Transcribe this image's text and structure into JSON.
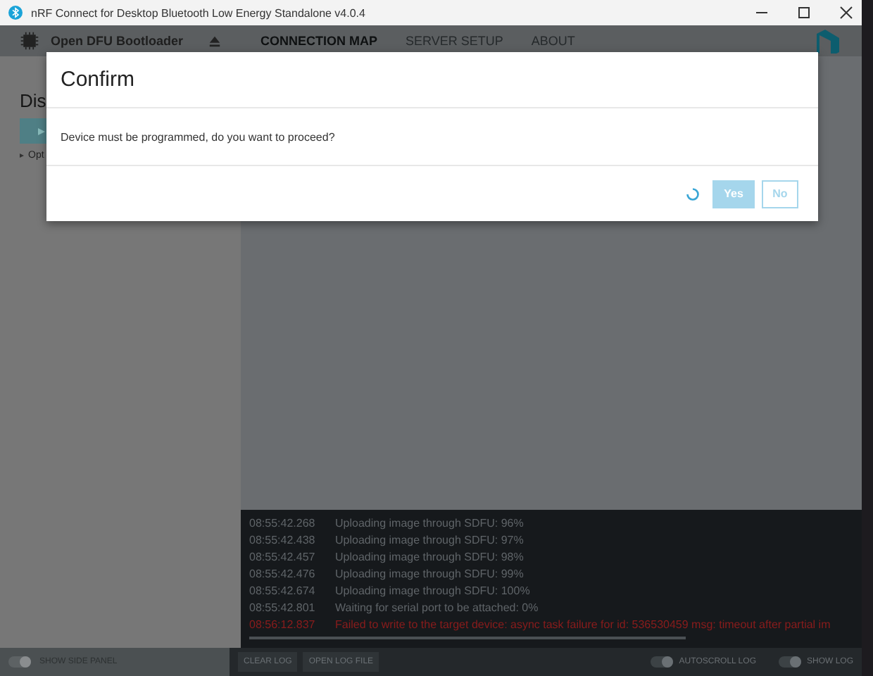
{
  "window": {
    "title": "nRF Connect for Desktop Bluetooth Low Energy Standalone v4.0.4"
  },
  "header": {
    "device_name": "Open DFU Bootloader",
    "tabs": [
      {
        "label": "CONNECTION MAP",
        "selected": true
      },
      {
        "label": "SERVER SETUP",
        "selected": false
      },
      {
        "label": "ABOUT",
        "selected": false
      }
    ]
  },
  "sidebar": {
    "heading": "Dis",
    "option": "Opt",
    "toggle": {
      "label": "SHOW SIDE PANEL",
      "on": true
    }
  },
  "dialog": {
    "title": "Confirm",
    "message": "Device must be programmed, do you want to proceed?",
    "busy": true,
    "buttons": [
      {
        "label": "Yes",
        "kind": "primary",
        "disabled": true
      },
      {
        "label": "No",
        "kind": "secondary",
        "disabled": true
      }
    ]
  },
  "log": {
    "entries": [
      {
        "time": "08:55:42.268",
        "message": "Uploading image through SDFU: 96%",
        "kind": "info"
      },
      {
        "time": "08:55:42.438",
        "message": "Uploading image through SDFU: 97%",
        "kind": "info"
      },
      {
        "time": "08:55:42.457",
        "message": "Uploading image through SDFU: 98%",
        "kind": "info"
      },
      {
        "time": "08:55:42.476",
        "message": "Uploading image through SDFU: 99%",
        "kind": "info"
      },
      {
        "time": "08:55:42.674",
        "message": "Uploading image through SDFU: 100%",
        "kind": "info"
      },
      {
        "time": "08:55:42.801",
        "message": "Waiting for serial port to be attached: 0%",
        "kind": "info"
      },
      {
        "time": "08:56:12.837",
        "message": "Failed to write to the target device: async task failure for id: 536530459 msg: timeout after partial im",
        "kind": "error"
      }
    ],
    "buttons": [
      "CLEAR LOG",
      "OPEN LOG FILE"
    ],
    "toggles": [
      {
        "label": "AUTOSCROLL LOG",
        "on": true
      },
      {
        "label": "SHOW LOG",
        "on": true
      }
    ]
  }
}
